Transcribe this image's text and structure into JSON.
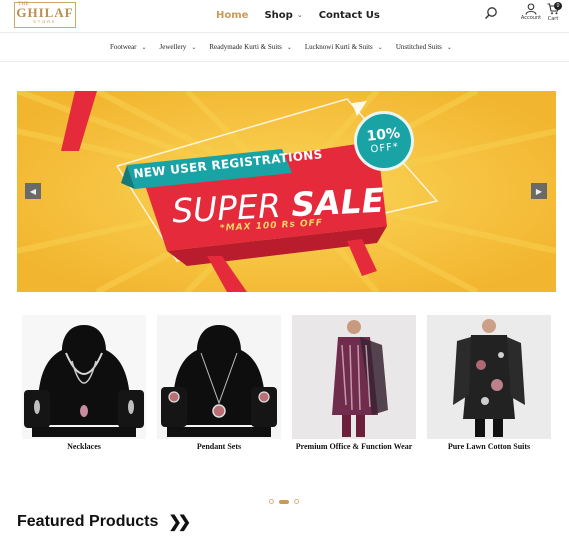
{
  "brand": {
    "the": "THE",
    "name": "GHILAF",
    "store": "STORE"
  },
  "header_nav": [
    {
      "label": "Home",
      "active": true
    },
    {
      "label": "Shop",
      "has_dropdown": true
    },
    {
      "label": "Contact Us"
    }
  ],
  "header_actions": {
    "account_label": "Account",
    "cart_label": "Cart",
    "cart_count": "0"
  },
  "category_nav": [
    {
      "label": "Footwear"
    },
    {
      "label": "Jewellery"
    },
    {
      "label": "Readymade Kurti & Suits"
    },
    {
      "label": "Lucknowi Kurti & Suits"
    },
    {
      "label": "Unstitched Suits"
    }
  ],
  "banner": {
    "tagline": "NEW USER REGISTRATIONS",
    "headline_light": "SUPER",
    "headline_bold": "SALE",
    "subline": "*MAX 100 Rs OFF",
    "discount_pct": "10%",
    "discount_off": "OFF*",
    "prev_icon": "chevron-left-icon",
    "next_icon": "chevron-right-icon"
  },
  "product_categories": [
    {
      "title": "Necklaces"
    },
    {
      "title": "Pendant Sets"
    },
    {
      "title": "Premium Office & Function Wear"
    },
    {
      "title": "Pure Lawn Cotton Suits"
    }
  ],
  "carousel": {
    "slides": 3,
    "active": 2
  },
  "featured": {
    "heading": "Featured Products",
    "icon": "double-chevron-right-icon"
  },
  "colors": {
    "accent": "#c89b5a",
    "banner_yellow": "#f6c23f",
    "banner_red": "#e52a3c",
    "badge_teal": "#1aa3a5"
  }
}
